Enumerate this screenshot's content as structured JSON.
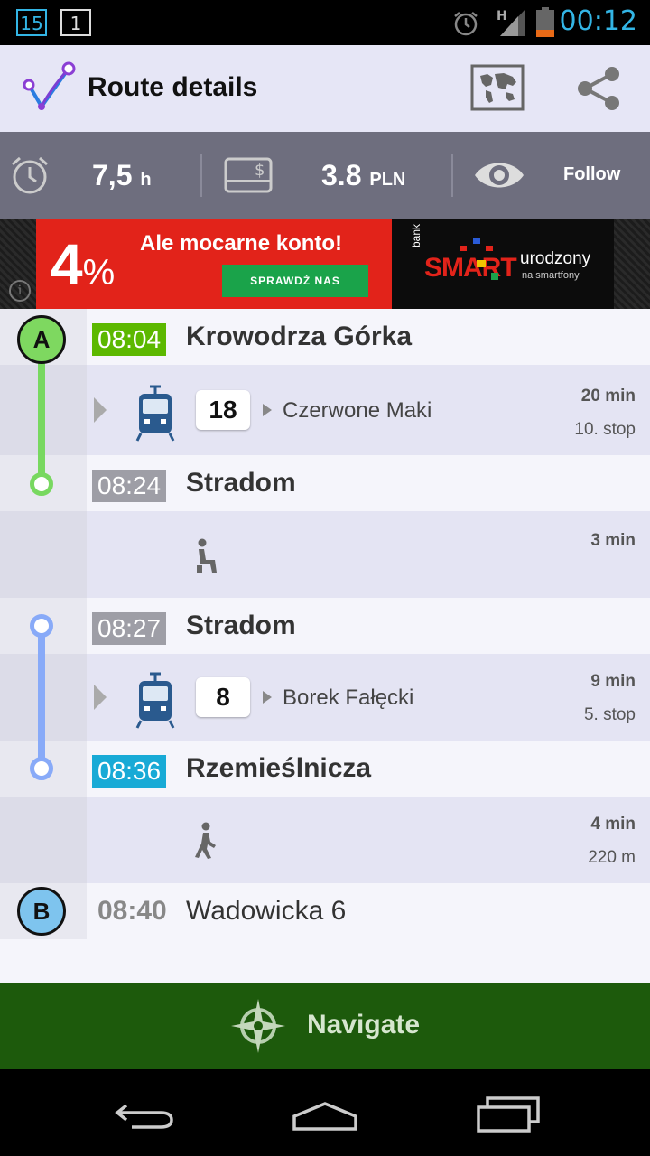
{
  "status_bar": {
    "notif_1": "15",
    "notif_2": "1",
    "network": "H",
    "time": "00:12"
  },
  "action_bar": {
    "title": "Route details",
    "icons": [
      "route-logo-icon",
      "map-icon",
      "share-icon"
    ]
  },
  "summary": {
    "duration_value": "7,5",
    "duration_unit": "h",
    "price_value": "3.8",
    "price_unit": "PLN",
    "follow_label": "Follow",
    "ticket_symbol": "$"
  },
  "ad": {
    "info_glyph": "i",
    "percent": "4",
    "percent_sign": "%",
    "headline": "Ale mocarne konto!",
    "button": "SPRAWDŹ NAS",
    "bank": "bank",
    "brand": "SMART",
    "tagline": "urodzony",
    "tagline_sub": "na smartfony"
  },
  "route": {
    "start_marker": "A",
    "end_marker": "B",
    "stops": [
      {
        "time": "08:04",
        "name": "Krowodrza Górka",
        "color": "#5cb800"
      },
      {
        "time": "08:24",
        "name": "Stradom",
        "color": "#9e9ea6"
      },
      {
        "time": "08:27",
        "name": "Stradom",
        "color": "#9e9ea6"
      },
      {
        "time": "08:36",
        "name": "Rzemieślnicza",
        "color": "#18aad6"
      },
      {
        "time": "08:40",
        "name": "Wadowicka 6"
      }
    ],
    "legs": [
      {
        "mode": "tram",
        "line": "18",
        "direction": "Czerwone Maki",
        "duration": "20 min",
        "detail": "10. stop"
      },
      {
        "mode": "wait",
        "duration": "3 min"
      },
      {
        "mode": "tram",
        "line": "8",
        "direction": "Borek Fałęcki",
        "duration": "9 min",
        "detail": "5. stop"
      },
      {
        "mode": "walk",
        "duration": "4 min",
        "detail": "220 m"
      }
    ],
    "track_colors": {
      "first": "#78d860",
      "second": "#88aaf8",
      "start": "#7ed860",
      "end": "#7ec4ee"
    }
  },
  "navigate": {
    "label": "Navigate"
  }
}
